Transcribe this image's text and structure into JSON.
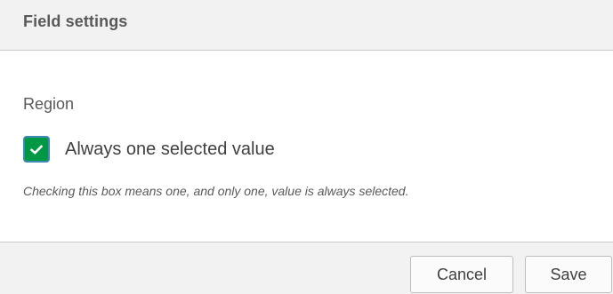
{
  "dialog": {
    "title": "Field settings"
  },
  "field": {
    "name": "Region",
    "always_one_selected": {
      "checked": true,
      "label": "Always one selected value",
      "help_text": "Checking this box means one, and only one, value is always selected."
    }
  },
  "footer": {
    "cancel_label": "Cancel",
    "save_label": "Save"
  },
  "icons": {
    "checkbox_check": "check-icon"
  },
  "colors": {
    "checkbox_fill": "#009845",
    "checkbox_focus_border": "#3f8ab3",
    "header_background": "#f2f2f2",
    "text": "#404040"
  }
}
